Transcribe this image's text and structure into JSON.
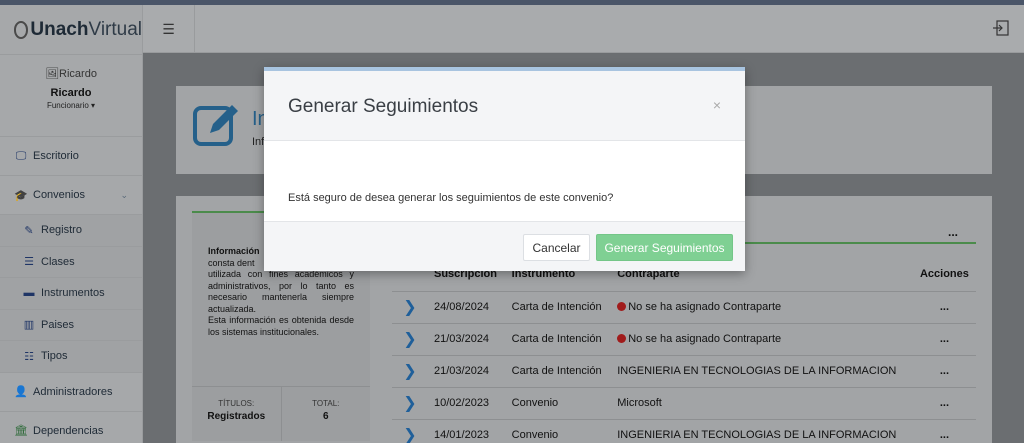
{
  "brand": {
    "bold": "Unach",
    "light": "Virtual"
  },
  "user": {
    "image_alt": "Ricardo",
    "name": "Ricardo",
    "role": "Funcionario"
  },
  "sidebar": {
    "items": [
      {
        "label": "Escritorio",
        "icon": "monitor-icon"
      },
      {
        "label": "Convenios",
        "icon": "graduation-cap-icon"
      },
      {
        "label": "Registro",
        "icon": "edit-icon"
      },
      {
        "label": "Clases",
        "icon": "list-icon"
      },
      {
        "label": "Instrumentos",
        "icon": "briefcase-icon"
      },
      {
        "label": "Paises",
        "icon": "columns-icon"
      },
      {
        "label": "Tipos",
        "icon": "list-alt-icon"
      },
      {
        "label": "Administradores",
        "icon": "users-icon"
      },
      {
        "label": "Dependencias",
        "icon": "institution-icon"
      }
    ]
  },
  "page": {
    "title_partial": "In",
    "subtitle_partial": "Inf"
  },
  "info": {
    "heading": "Información",
    "text_line1": "consta dent",
    "text_rest": "utilizada con fines académicos y administrativos, por lo tanto es necesario mantenerla siempre actualizada.",
    "text_more": "Esta información es obtenida desde los sistemas institucionales.",
    "stats": [
      {
        "key": "TÍTULOS:",
        "value": "Registrados"
      },
      {
        "key": "TOTAL:",
        "value": "6"
      }
    ]
  },
  "table": {
    "menu": "...",
    "headers": [
      "Suscripción",
      "Instrumento",
      "Contraparte",
      "Acciones"
    ],
    "rows": [
      {
        "date": "24/08/2024",
        "instrument": "Carta de Intención",
        "counterpart": "No se ha asignado Contraparte",
        "alert": true,
        "action": "..."
      },
      {
        "date": "21/03/2024",
        "instrument": "Carta de Intención",
        "counterpart": "No se ha asignado Contraparte",
        "alert": true,
        "action": "..."
      },
      {
        "date": "21/03/2024",
        "instrument": "Carta de Intención",
        "counterpart": "INGENIERIA EN TECNOLOGIAS DE LA INFORMACION",
        "alert": false,
        "action": "..."
      },
      {
        "date": "10/02/2023",
        "instrument": "Convenio",
        "counterpart": "Microsoft",
        "alert": false,
        "action": "..."
      },
      {
        "date": "14/01/2023",
        "instrument": "Convenio",
        "counterpart": "INGENIERIA EN TECNOLOGIAS DE LA INFORMACION",
        "alert": false,
        "action": "..."
      }
    ]
  },
  "modal": {
    "title": "Generar Seguimientos",
    "close": "×",
    "message": "Está seguro de desea generar los seguimientos de este convenio?",
    "cancel_label": "Cancelar",
    "confirm_label": "Generar Seguimientos"
  },
  "colors": {
    "accent_green": "#7fd093",
    "brand_blue": "#25608a",
    "alert_red": "#a01b1b"
  }
}
